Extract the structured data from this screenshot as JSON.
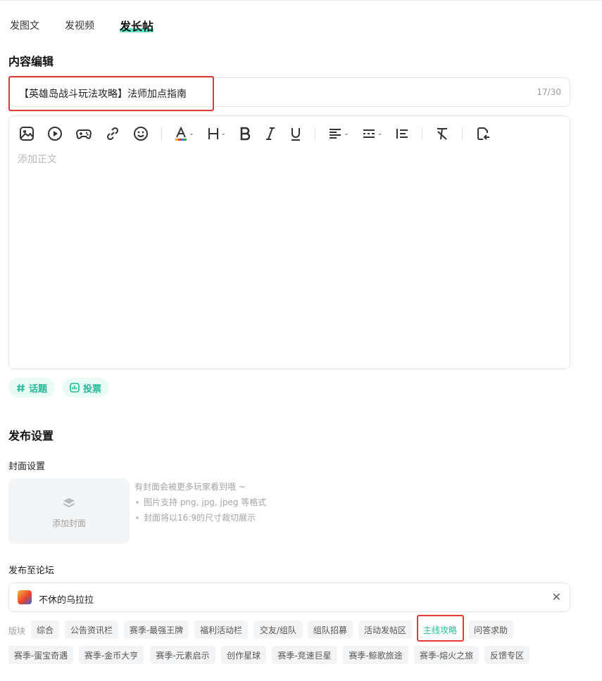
{
  "tabs": [
    {
      "label": "发图文"
    },
    {
      "label": "发视频"
    },
    {
      "label": "发长帖"
    }
  ],
  "content_section": {
    "title": "内容编辑",
    "title_value": "【英雄岛战斗玩法攻略】法师加点指南",
    "title_count": "17/30",
    "body_placeholder": "添加正文"
  },
  "toolbar_icons": [
    "image-icon",
    "video-icon",
    "gamepad-icon",
    "link-icon",
    "emoji-icon",
    "text-color-icon",
    "heading-icon",
    "bold-icon",
    "italic-icon",
    "underline-icon",
    "align-icon",
    "line-spacing-icon",
    "list-icon",
    "clear-format-icon",
    "undo-icon"
  ],
  "accent_color": "#24b896",
  "chips": {
    "topic": "话题",
    "vote": "投票"
  },
  "publish_section": {
    "title": "发布设置",
    "cover_label": "封面设置",
    "cover_add": "添加封面",
    "cover_tips": [
      "有封面会被更多玩家看到哦 ~",
      "图片支持 png, jpg, jpeg 等格式",
      "封面将以16:9的尺寸裁切展示"
    ],
    "forum_label": "发布至论坛",
    "forum_name": "不休的乌拉拉",
    "forum_clear": "✕",
    "board_label": "版块",
    "boards_row1": [
      "综合",
      "公告资讯栏",
      "赛季-最强王牌",
      "福利活动栏",
      "交友/组队",
      "组队招募",
      "活动发帖区",
      "主线攻略",
      "问答求助"
    ],
    "boards_row2": [
      "赛季-蛋宝奇遇",
      "赛季-金币大亨",
      "赛季-元素启示",
      "创作星球",
      "赛季-竞速巨星",
      "赛季-鲸歌旅途",
      "赛季-熔火之旅",
      "反馈专区"
    ],
    "active_board": "主线攻略"
  }
}
